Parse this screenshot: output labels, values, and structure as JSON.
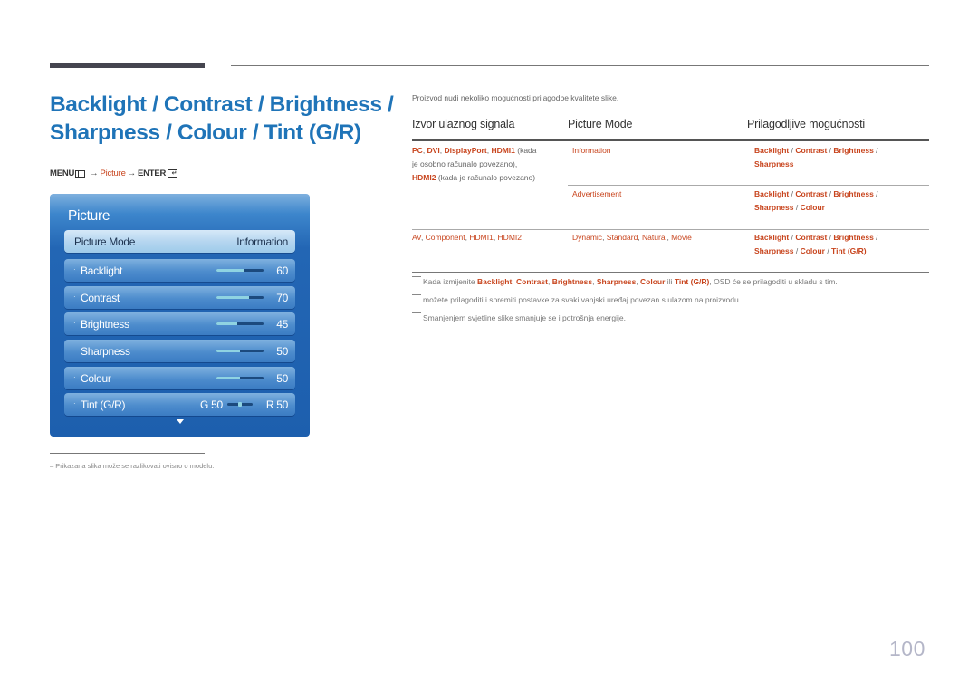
{
  "header": {
    "title_line1": "Backlight / Contrast / Brightness /",
    "title_line2": "Sharpness / Colour / Tint (G/R)"
  },
  "menu_path": {
    "menu": "MENU",
    "menu_icon": "menu-grid-icon",
    "arrow": "→",
    "picture": "Picture",
    "enter": "ENTER",
    "enter_icon": "enter-icon"
  },
  "osd": {
    "title": "Picture",
    "picture_mode": {
      "label": "Picture Mode",
      "value": "Information"
    },
    "items": [
      {
        "label": "Backlight",
        "value": "60",
        "level": 60
      },
      {
        "label": "Contrast",
        "value": "70",
        "level": 70
      },
      {
        "label": "Brightness",
        "value": "45",
        "level": 45
      },
      {
        "label": "Sharpness",
        "value": "50",
        "level": 50
      },
      {
        "label": "Colour",
        "value": "50",
        "level": 50
      }
    ],
    "tint": {
      "label": "Tint (G/R)",
      "g_value": "G 50",
      "r_value": "R 50",
      "balance": 50
    },
    "scroll_icon": "triangle-down-icon"
  },
  "footnote": "–  Prikazana slika može se razlikovati ovisno o modelu.",
  "intro": "Proizvod nudi nekoliko mogućnosti prilagodbe kvalitete slike.",
  "table": {
    "headers": [
      "Izvor ulaznog signala",
      "Picture Mode",
      "Prilagodljive mogućnosti"
    ],
    "row1": {
      "source_parts": [
        "PC",
        "DVI",
        "DisplayPort",
        "HDMI1"
      ],
      "source_tail": " (kada",
      "source_line2": "je osobno računalo povezano),",
      "source_hdmi2": "HDMI2",
      "source_line3_tail": " (kada je računalo povezano)",
      "mode_a": "Information",
      "options_a_line1": [
        "Backlight",
        "Contrast",
        "Brightness"
      ],
      "options_a_line2": [
        "Sharpness"
      ],
      "mode_b": "Advertisement",
      "options_b_line1": [
        "Backlight",
        "Contrast",
        "Brightness"
      ],
      "options_b_line2": [
        "Sharpness",
        "Colour"
      ]
    },
    "row2": {
      "sources": [
        "AV",
        "Component",
        "HDMI1",
        "HDMI2"
      ],
      "modes": [
        "Dynamic",
        "Standard",
        "Natural",
        "Movie"
      ],
      "options_line1": [
        "Backlight",
        "Contrast",
        "Brightness"
      ],
      "options_line2": [
        "Sharpness",
        "Colour",
        "Tint (G/R)"
      ]
    }
  },
  "notes": {
    "note1_prefix": "Kada izmijenite ",
    "note1_items": [
      "Backlight",
      "Contrast",
      "Brightness",
      "Sharpness",
      "Colour"
    ],
    "note1_or": " ili ",
    "note1_last": "Tint (G/R)",
    "note1_suffix": ", OSD će se prilagoditi u skladu s tim.",
    "note2": "možete prilagoditi i spremiti postavke za svaki vanjski uređaj povezan s ulazom na proizvodu.",
    "note3": "Smanjenjem svjetline slike smanjuje se i potrošnja energije."
  },
  "page_number": "100",
  "colors": {
    "title_blue": "#1f74b8",
    "accent_orange": "#c8451e",
    "osd_blue": "#1d5fae",
    "slider_fill": "#8fd3e2"
  }
}
